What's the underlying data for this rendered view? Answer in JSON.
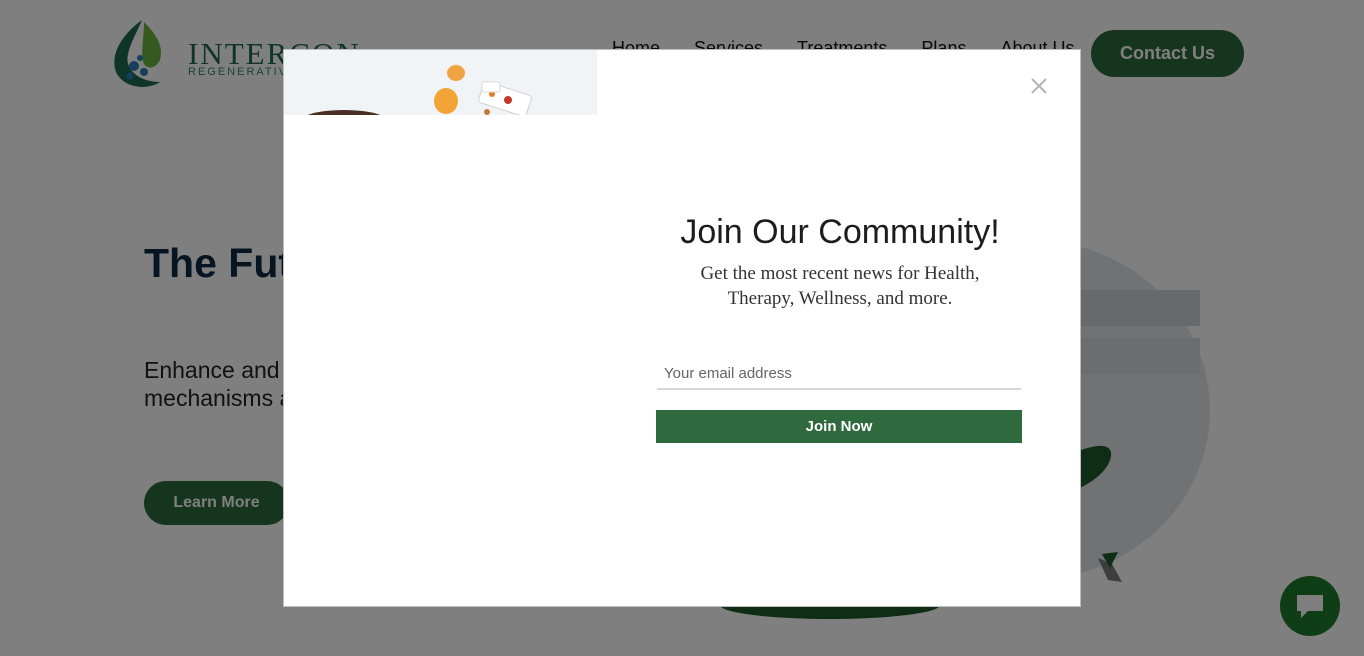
{
  "header": {
    "logo_text": "INTERCON",
    "logo_sub": "REGENERATIVE",
    "nav": [
      "Home",
      "Services",
      "Treatments",
      "Plans",
      "About Us"
    ],
    "contact_label": "Contact Us"
  },
  "hero": {
    "title": "The Future of Healthcare",
    "text": "Enhance and restore your body's natural healing mechanisms as quickly and effectively as possible.",
    "learn_label": "Learn More"
  },
  "modal": {
    "title": "Join Our Community!",
    "subtitle": "Get the most recent news for Health, Therapy, Wellness, and more.",
    "email_placeholder": "Your email address",
    "email_value": "",
    "join_label": "Join Now"
  },
  "colors": {
    "brand_green": "#2c6b3c",
    "overlay": "rgba(0,0,0,0.5)",
    "chat_green": "#1f7a2c"
  },
  "icons": {
    "close": "close-icon",
    "chat": "chat-icon"
  }
}
